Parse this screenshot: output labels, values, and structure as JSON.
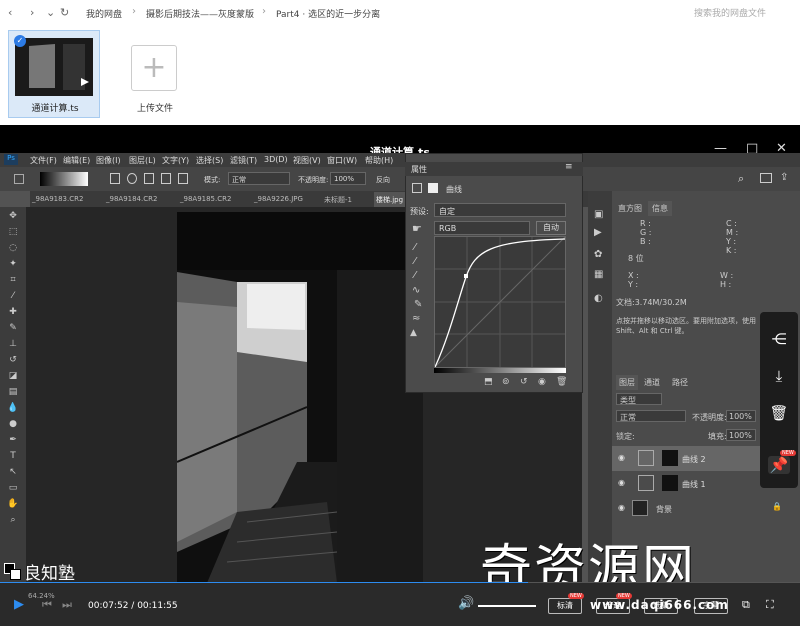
{
  "nav": {
    "breadcrumbs": [
      "我的网盘",
      "摄影后期技法——灰度蒙版",
      "Part4 · 选区的近一步分离"
    ],
    "search_placeholder": "搜索我的网盘文件"
  },
  "files": [
    {
      "name": "通道计算.ts"
    },
    {
      "name": "上传文件"
    }
  ],
  "player": {
    "title": "通道计算.ts",
    "current_time": "00:07:52",
    "total_time": "00:11:55",
    "progress": 0.66,
    "time_sep": " / ",
    "watermark_logo": "良知塾",
    "watermark_big": "奇资源网",
    "watermark_url": "www.daqi666.com",
    "controls": [
      "标清",
      "倍速",
      "选集",
      "字幕"
    ]
  },
  "ps": {
    "menu": [
      "文件(F)",
      "编辑(E)",
      "图像(I)",
      "图层(L)",
      "文字(Y)",
      "选择(S)",
      "滤镜(T)",
      "3D(D)",
      "视图(V)",
      "窗口(W)",
      "帮助(H)"
    ],
    "options": {
      "mode_label": "模式:",
      "mode": "正常",
      "opacity_label": "不透明度:",
      "opacity": "100%",
      "reverse": "反向"
    },
    "tabs": [
      "_98A9183.CR2",
      "_98A9184.CR2",
      "_98A9185.CR2",
      "_98A9226.JPG",
      "未标题-1",
      "楼梯.jpg"
    ],
    "zoom": "64.24%",
    "doc": "文档:3.74M/30.2M",
    "properties": {
      "title": "属性",
      "type": "曲线",
      "preset_label": "预设:",
      "preset": "自定",
      "channel": "RGB",
      "auto": "自动"
    },
    "info_tabs": [
      "直方图",
      "信息"
    ],
    "info": {
      "r": "R :",
      "g": "G :",
      "b": "B :",
      "bit": "8 位",
      "c": "C :",
      "m": "M :",
      "y": "Y :",
      "k": "K :",
      "x": "X :",
      "yy": "Y :",
      "w": "W :",
      "h": "H :",
      "doc": "文档:3.74M/30.2M",
      "hint": "点按并拖移以移动选区。要用附加选项，使用 Shift、Alt 和 Ctrl 键。"
    },
    "layer_tabs": [
      "图层",
      "通道",
      "路径"
    ],
    "layer_kind": "类型",
    "blend": "正常",
    "lopacity_label": "不透明度:",
    "lopacity": "100%",
    "lock_label": "锁定:",
    "fill_label": "填充:",
    "fill": "100%",
    "layers": [
      {
        "name": "曲线 2"
      },
      {
        "name": "曲线 1"
      },
      {
        "name": "背景"
      }
    ]
  },
  "colors": {
    "accent": "#2d8cf0",
    "badge": "#e53935"
  }
}
